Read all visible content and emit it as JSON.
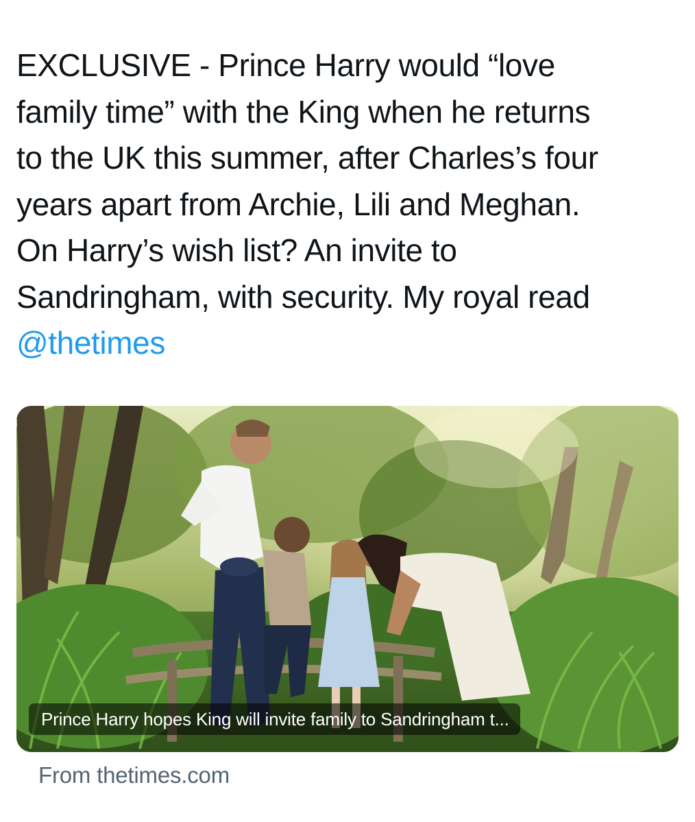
{
  "tweet": {
    "lines": [
      "EXCLUSIVE - Prince Harry would “love",
      "family time” with the King when he returns",
      "to the UK this summer, after Charles’s four",
      "years apart from Archie, Lili and Meghan.",
      "On Harry’s wish list? An invite to",
      "Sandringham, with security. My royal read"
    ],
    "mention": "@thetimes"
  },
  "card": {
    "caption": "Prince Harry hopes King will invite family to Sandringham t...",
    "source": "From thetimes.com"
  },
  "colors": {
    "text": "#0f1419",
    "link": "#1d9bf0",
    "secondary": "#536471"
  }
}
